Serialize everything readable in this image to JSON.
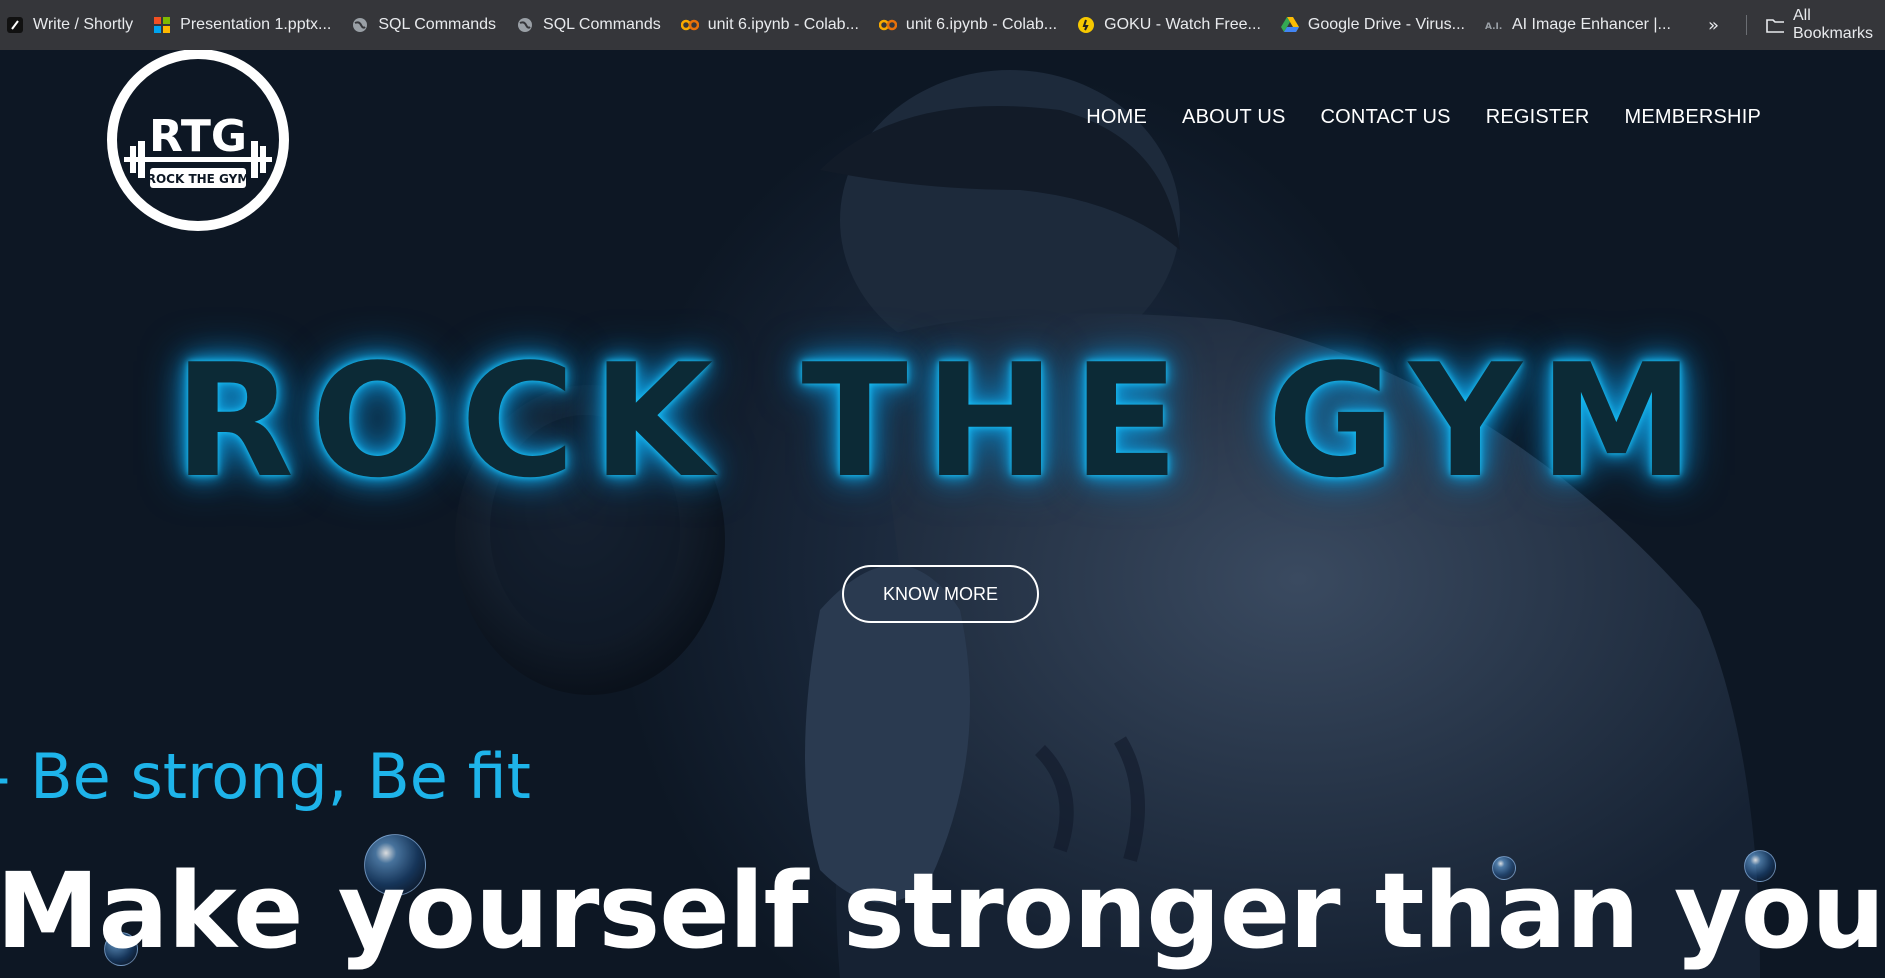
{
  "bookmarks": [
    {
      "label": "Write / Shortly",
      "icon": "shortly-icon"
    },
    {
      "label": "Presentation 1.pptx...",
      "icon": "microsoft-icon"
    },
    {
      "label": "SQL Commands",
      "icon": "globe-icon"
    },
    {
      "label": "SQL Commands",
      "icon": "globe-icon"
    },
    {
      "label": "unit 6.ipynb - Colab...",
      "icon": "colab-icon"
    },
    {
      "label": "unit 6.ipynb - Colab...",
      "icon": "colab-icon"
    },
    {
      "label": "GOKU - Watch Free...",
      "icon": "goku-icon"
    },
    {
      "label": "Google Drive - Virus...",
      "icon": "google-drive-icon"
    },
    {
      "label": "AI Image Enhancer |...",
      "icon": "ai-icon"
    }
  ],
  "bookmarks_more": "»",
  "all_bookmarks": "All Bookmarks",
  "logo": {
    "monogram": "RTG",
    "text": "ROCK THE GYM"
  },
  "nav": [
    "HOME",
    "ABOUT US",
    "CONTACT US",
    "REGISTER",
    "MEMBERSHIP"
  ],
  "hero": {
    "title": "ROCK THE GYM",
    "button": "KNOW MORE",
    "tagline": "- Be strong, Be fit",
    "headline": "Make yourself stronger than your"
  },
  "colors": {
    "bookmarks_bar": "#35363a",
    "hero_bg": "#0d1724",
    "accent_cyan": "#1eb4ea",
    "title_glow": "#19c2f5"
  }
}
